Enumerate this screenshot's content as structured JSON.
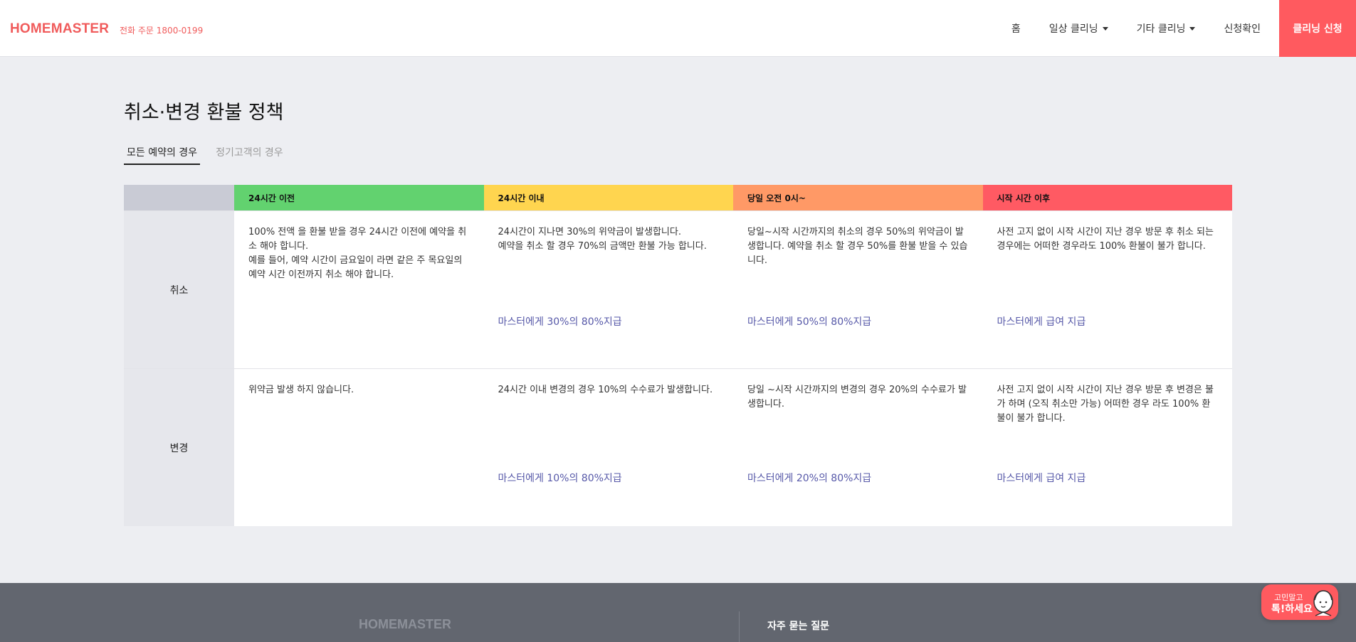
{
  "header": {
    "logo": "HOMEMASTER",
    "phone": "전화 주문 1800-0199",
    "nav": [
      {
        "label": "홈",
        "dropdown": false
      },
      {
        "label": "일상 클리닝",
        "dropdown": true
      },
      {
        "label": "기타 클리닝",
        "dropdown": true
      },
      {
        "label": "신청확인",
        "dropdown": false
      }
    ],
    "cta": "클리닝 신청"
  },
  "main": {
    "title": "취소·변경 환불 정책",
    "tabs": [
      {
        "label": "모든 예약의 경우",
        "active": true
      },
      {
        "label": "정기고객의 경우",
        "active": false
      }
    ]
  },
  "policy": {
    "columns": [
      {
        "label": "24시간 이전",
        "color": "#62d26f"
      },
      {
        "label": "24시간 이내",
        "color": "#ffd54f"
      },
      {
        "label": "당일 오전 0시~",
        "color": "#ff9966"
      },
      {
        "label": "시작 시간 이후",
        "color": "#ff5a63"
      }
    ],
    "rows": [
      {
        "label": "취소",
        "cells": [
          {
            "text": "100% 전액 을 환불 받을 경우 24시간 이전에 예약을 취소 해야 합니다.\n예를 들어, 예약 시간이 금요일이 라면 같은 주 목요일의 예약 시간 이전까지 취소 해야 합니다.",
            "pay": ""
          },
          {
            "text": "24시간이 지나면 30%의 위약금이 발생합니다.\n예약을 취소 할 경우 70%의 금액만 환불 가능 합니다.",
            "pay": "마스터에게 30%의 80%지급"
          },
          {
            "text": "당일~시작 시간까지의 취소의 경우 50%의 위약금이 발생합니다. 예약을 취소 할 경우 50%를 환불 받을 수 있습니다.",
            "pay": "마스터에게 50%의 80%지급"
          },
          {
            "text": "사전 고지 없이 시작 시간이 지난 경우 방문 후 취소 되는 경우에는 어떠한 경우라도 100% 환불이 불가 합니다.",
            "pay": "마스터에게 급여 지급"
          }
        ]
      },
      {
        "label": "변경",
        "cells": [
          {
            "text": "위약금 발생 하지 않습니다.",
            "pay": ""
          },
          {
            "text": "24시간 이내 변경의 경우 10%의 수수료가 발생합니다.",
            "pay": "마스터에게 10%의 80%지급"
          },
          {
            "text": "당일 ~시작 시간까지의 변경의 경우 20%의 수수료가 발생합니다.",
            "pay": "마스터에게 20%의 80%지급"
          },
          {
            "text": "사전 고지 없이 시작 시간이 지난 경우 방문 후 변경은 불가 하며 (오직 취소만 가능) 어떠한 경우 라도 100% 환불이 불가 합니다.",
            "pay": "마스터에게 급여 지급"
          }
        ]
      }
    ]
  },
  "footer": {
    "logo": "HOMEMASTER",
    "faq": "자주 묻는 질문"
  },
  "chat": {
    "line1": "고민말고",
    "line2": "톡!하세요"
  }
}
